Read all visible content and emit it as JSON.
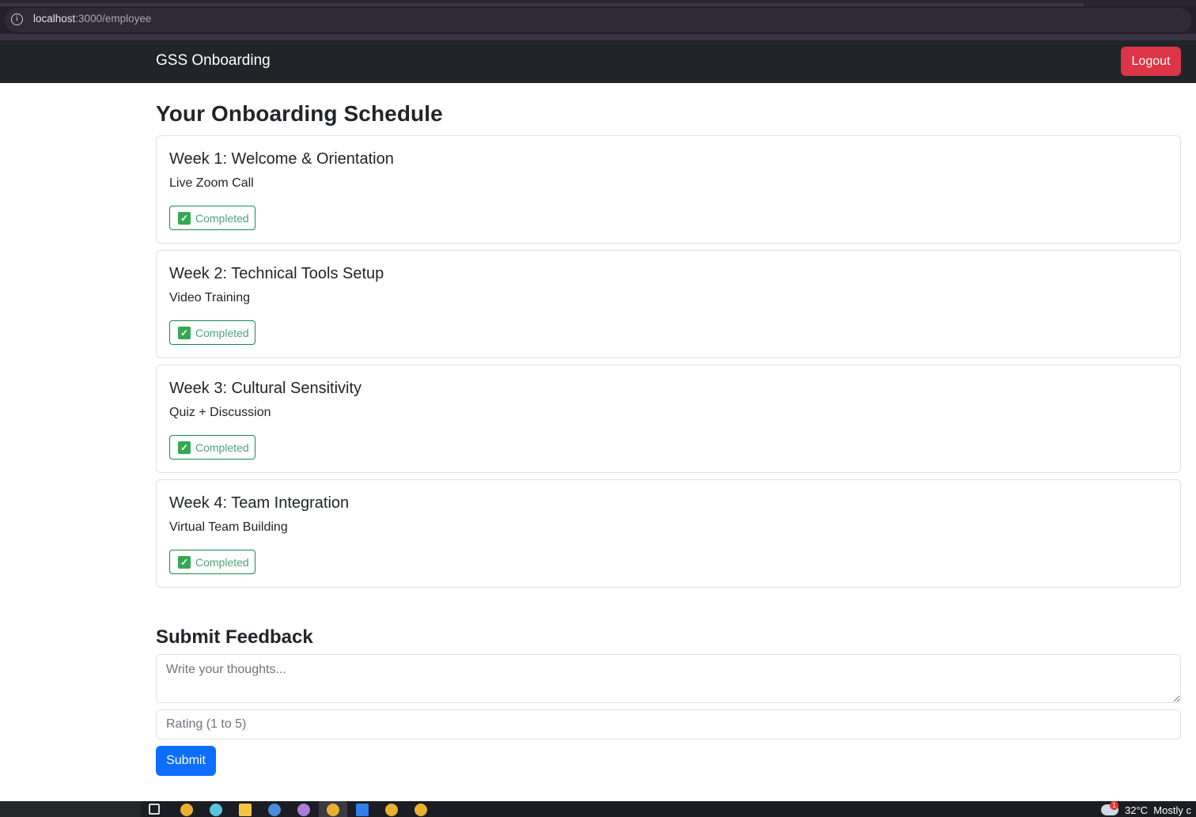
{
  "browser": {
    "url_host": "localhost",
    "url_path": ":3000/employee"
  },
  "navbar": {
    "brand": "GSS Onboarding",
    "logout_label": "Logout"
  },
  "main": {
    "title": "Your Onboarding Schedule",
    "weeks": [
      {
        "title": "Week 1: Welcome & Orientation",
        "format": "Live Zoom Call",
        "status": "Completed"
      },
      {
        "title": "Week 2: Technical Tools Setup",
        "format": "Video Training",
        "status": "Completed"
      },
      {
        "title": "Week 3: Cultural Sensitivity",
        "format": "Quiz + Discussion",
        "status": "Completed"
      },
      {
        "title": "Week 4: Team Integration",
        "format": "Virtual Team Building",
        "status": "Completed"
      }
    ]
  },
  "feedback": {
    "title": "Submit Feedback",
    "thoughts_placeholder": "Write your thoughts...",
    "rating_placeholder": "Rating (1 to 5)",
    "submit_label": "Submit"
  },
  "taskbar": {
    "notification_count": "1",
    "temperature": "32°C",
    "weather": "Mostly c"
  },
  "colors": {
    "navbar_bg": "#212529",
    "logout": "#dc3545",
    "submit": "#0d6efd",
    "success": "#198754"
  }
}
